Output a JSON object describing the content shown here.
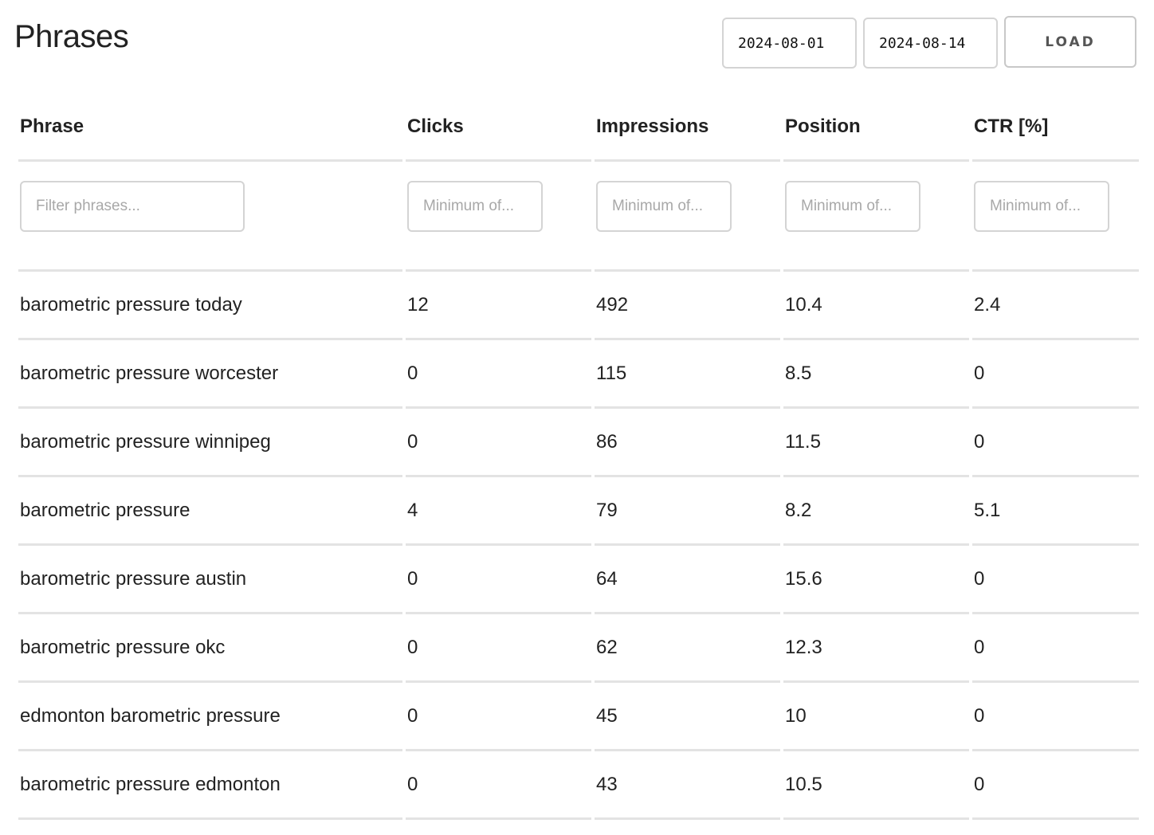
{
  "page": {
    "title": "Phrases"
  },
  "toolbar": {
    "date_from": "2024-08-01",
    "date_to": "2024-08-14",
    "load_label": "LOAD"
  },
  "table": {
    "columns": [
      {
        "key": "phrase",
        "label": "Phrase",
        "filter_placeholder": "Filter phrases..."
      },
      {
        "key": "clicks",
        "label": "Clicks",
        "filter_placeholder": "Minimum of..."
      },
      {
        "key": "impressions",
        "label": "Impressions",
        "filter_placeholder": "Minimum of..."
      },
      {
        "key": "position",
        "label": "Position",
        "filter_placeholder": "Minimum of..."
      },
      {
        "key": "ctr",
        "label": "CTR [%]",
        "filter_placeholder": "Minimum of..."
      }
    ],
    "rows": [
      {
        "phrase": "barometric pressure today",
        "clicks": "12",
        "impressions": "492",
        "position": "10.4",
        "ctr": "2.4"
      },
      {
        "phrase": "barometric pressure worcester",
        "clicks": "0",
        "impressions": "115",
        "position": "8.5",
        "ctr": "0"
      },
      {
        "phrase": "barometric pressure winnipeg",
        "clicks": "0",
        "impressions": "86",
        "position": "11.5",
        "ctr": "0"
      },
      {
        "phrase": "barometric pressure",
        "clicks": "4",
        "impressions": "79",
        "position": "8.2",
        "ctr": "5.1"
      },
      {
        "phrase": "barometric pressure austin",
        "clicks": "0",
        "impressions": "64",
        "position": "15.6",
        "ctr": "0"
      },
      {
        "phrase": "barometric pressure okc",
        "clicks": "0",
        "impressions": "62",
        "position": "12.3",
        "ctr": "0"
      },
      {
        "phrase": "edmonton barometric pressure",
        "clicks": "0",
        "impressions": "45",
        "position": "10",
        "ctr": "0"
      },
      {
        "phrase": "barometric pressure edmonton",
        "clicks": "0",
        "impressions": "43",
        "position": "10.5",
        "ctr": "0"
      }
    ]
  }
}
